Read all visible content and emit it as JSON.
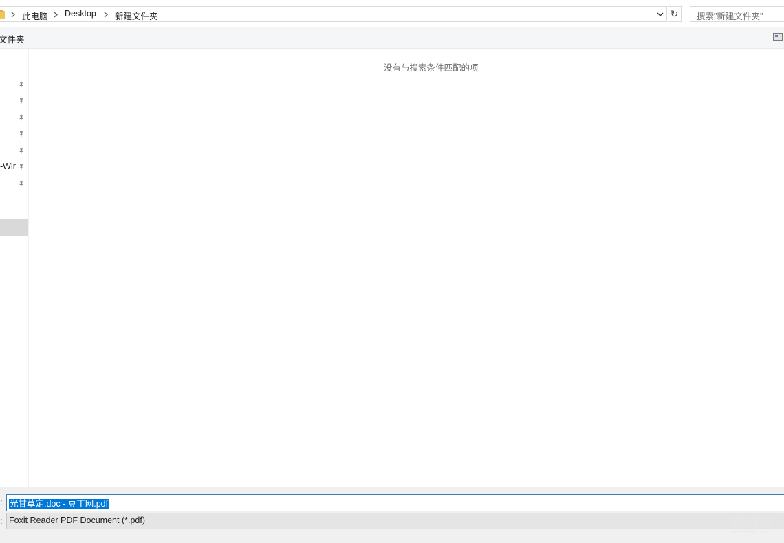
{
  "address_bar": {
    "crumbs": [
      "此电脑",
      "Desktop",
      "新建文件夹"
    ],
    "search_placeholder": "搜索\"新建文件夹\""
  },
  "toolbar": {
    "new_folder_label": "文件夹"
  },
  "nav_pane": {
    "pinned_count": 7,
    "visible_label": "-Wir"
  },
  "content": {
    "empty_message": "没有与搜索条件匹配的项。"
  },
  "bottom": {
    "filename_value": "光甘草定.doc - 豆丁网.pdf",
    "filetype_value": "Foxit Reader PDF Document (*.pdf)",
    "filename_colon": ":",
    "filetype_colon": ":"
  },
  "watermark": {
    "text": "电脑装配网",
    "sub": "www.dnzp.com"
  },
  "icons": [
    "folder-icon",
    "chevron-right-icon",
    "chevron-down-icon",
    "refresh-icon",
    "pin-icon",
    "view-toggle-icon"
  ]
}
